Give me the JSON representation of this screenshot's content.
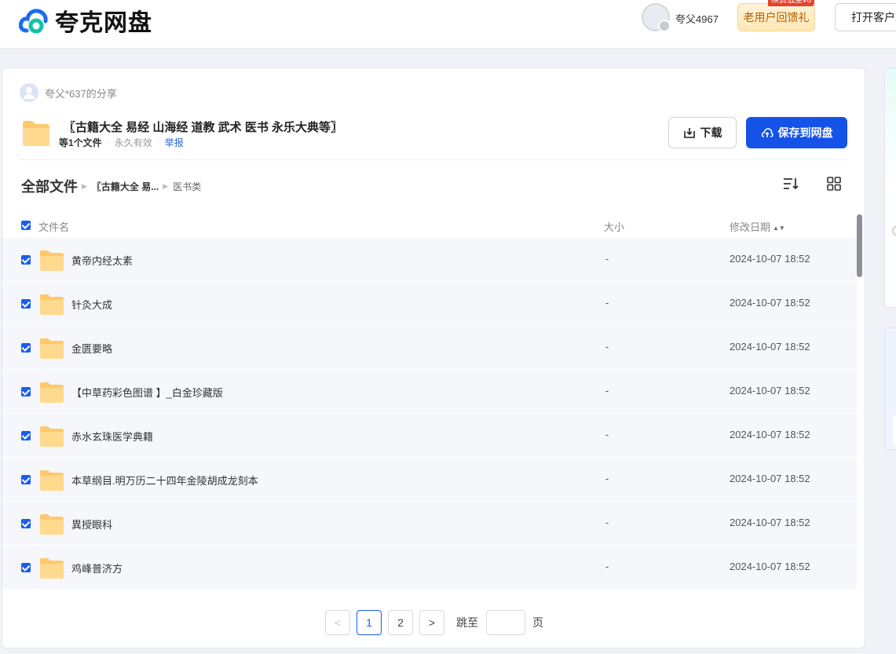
{
  "header": {
    "brand": "夸克网盘",
    "user_name": "夸父4967",
    "promo_label": "老用户回馈礼",
    "promo_tag": "续费低至¥6",
    "client_button": "打开客户端"
  },
  "share": {
    "sharer": "夸父*637的分享",
    "title": "〖古籍大全 易经 山海经 道教 武术 医书 永乐大典等〗",
    "count": "等1个文件",
    "validity": "永久有效",
    "report": "举报",
    "download_label": "下载",
    "save_label": "保存到网盘"
  },
  "breadcrumb": {
    "root": "全部文件",
    "level1": "〖古籍大全 易...",
    "level2": "医书类"
  },
  "table": {
    "col_name": "文件名",
    "col_size": "大小",
    "col_date": "修改日期",
    "rows": [
      {
        "name": "黄帝内经太素",
        "size": "-",
        "date": "2024-10-07 18:52"
      },
      {
        "name": "针灸大成",
        "size": "-",
        "date": "2024-10-07 18:52"
      },
      {
        "name": "金匮要略",
        "size": "-",
        "date": "2024-10-07 18:52"
      },
      {
        "name": "【中草药彩色图谱 】_白金珍藏版",
        "size": "-",
        "date": "2024-10-07 18:52"
      },
      {
        "name": "赤水玄珠医学典籍",
        "size": "-",
        "date": "2024-10-07 18:52"
      },
      {
        "name": "本草纲目.明万历二十四年金陵胡成龙刻本",
        "size": "-",
        "date": "2024-10-07 18:52"
      },
      {
        "name": "異授眼科",
        "size": "-",
        "date": "2024-10-07 18:52"
      },
      {
        "name": "鸡峰普济方",
        "size": "-",
        "date": "2024-10-07 18:52"
      }
    ]
  },
  "pagination": {
    "prev": "<",
    "pages": [
      "1",
      "2"
    ],
    "current": "1",
    "next": ">",
    "jump_label": "跳至",
    "jump_unit": "页"
  },
  "colors": {
    "primary": "#1552e8",
    "folder": "#ffc96b",
    "promo_text": "#b35c00"
  }
}
